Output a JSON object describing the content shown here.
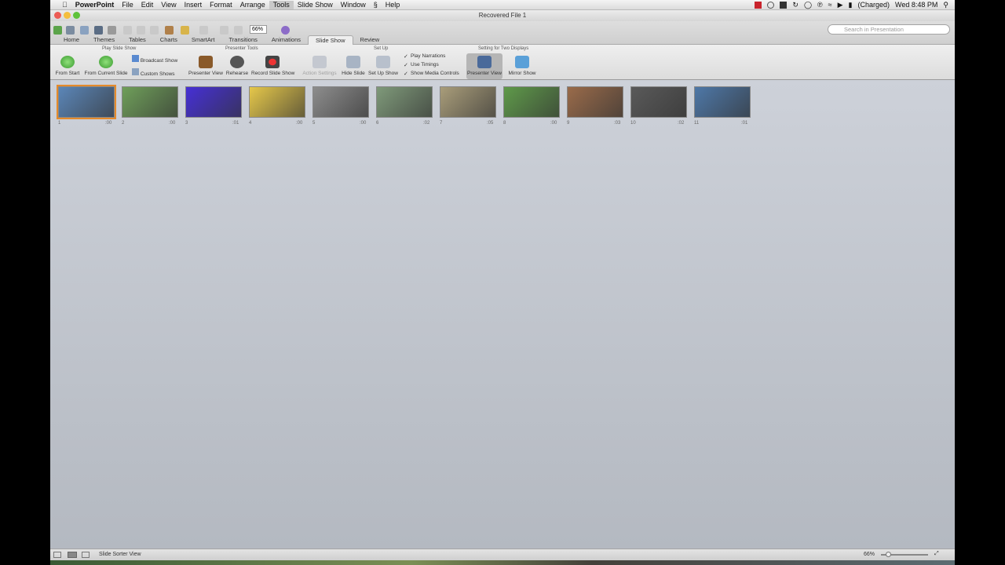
{
  "menubar": {
    "app_name": "PowerPoint",
    "items": [
      "File",
      "Edit",
      "View",
      "Insert",
      "Format",
      "Arrange",
      "Tools",
      "Slide Show",
      "Window",
      "Help"
    ],
    "active_item": "Tools",
    "battery": "(Charged)",
    "clock": "Wed 8:48 PM"
  },
  "window": {
    "title": "Recovered File 1",
    "zoom": "66%",
    "search_placeholder": "Search in Presentation"
  },
  "tabs": [
    "Home",
    "Themes",
    "Tables",
    "Charts",
    "SmartArt",
    "Transitions",
    "Animations",
    "Slide Show",
    "Review"
  ],
  "selected_tab": "Slide Show",
  "ribbon": {
    "groups": {
      "play": "Play Slide Show",
      "presenter": "Presenter Tools",
      "setup": "Set Up",
      "displays": "Setting for Two Displays"
    },
    "from_start": "From Start",
    "from_current": "From Current Slide",
    "broadcast": "Broadcast Show",
    "custom_shows": "Custom Shows",
    "presenter_view": "Presenter View",
    "rehearse": "Rehearse",
    "record": "Record Slide Show",
    "action_settings": "Action Settings",
    "hide_slide": "Hide Slide",
    "set_up_show": "Set Up Show",
    "play_narrations": "Play Narrations",
    "use_timings": "Use Timings",
    "show_media_controls": "Show Media Controls",
    "presenter_view_2": "Presenter View",
    "mirror_show": "Mirror Show"
  },
  "slides": [
    {
      "num": "1",
      "time": ":00",
      "bg": "#5b86b8"
    },
    {
      "num": "2",
      "time": ":00",
      "bg": "#6f9f5a"
    },
    {
      "num": "3",
      "time": ":01",
      "bg": "#4630d6"
    },
    {
      "num": "4",
      "time": ":00",
      "bg": "#e6c84a"
    },
    {
      "num": "5",
      "time": ":00",
      "bg": "#8d8d8d"
    },
    {
      "num": "6",
      "time": ":02",
      "bg": "#7f9a7a"
    },
    {
      "num": "7",
      "time": ":05",
      "bg": "#a99d7a"
    },
    {
      "num": "8",
      "time": ":00",
      "bg": "#5f9a4a"
    },
    {
      "num": "9",
      "time": ":03",
      "bg": "#9a6b4a"
    },
    {
      "num": "10",
      "time": ":02",
      "bg": "#5a5a5a"
    },
    {
      "num": "11",
      "time": ":01",
      "bg": "#4e78a8"
    }
  ],
  "status": {
    "view": "Slide Sorter View",
    "zoom": "66%"
  },
  "colors": {
    "selection": "#e48a2b",
    "sorter_bg": "#b4b9c1"
  }
}
